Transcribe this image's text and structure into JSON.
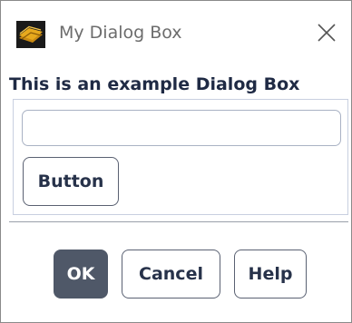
{
  "window": {
    "title": "My Dialog Box",
    "close_icon": "close-icon",
    "app_icon": "fluent-logo-icon"
  },
  "content": {
    "heading": "This is an example Dialog Box",
    "text_input": {
      "value": "",
      "placeholder": ""
    },
    "button_label": "Button"
  },
  "footer": {
    "ok_label": "OK",
    "cancel_label": "Cancel",
    "help_label": "Help"
  },
  "colors": {
    "primary_button": "#4f5868",
    "button_text": "#27324a",
    "heading_text": "#1f2a44"
  }
}
